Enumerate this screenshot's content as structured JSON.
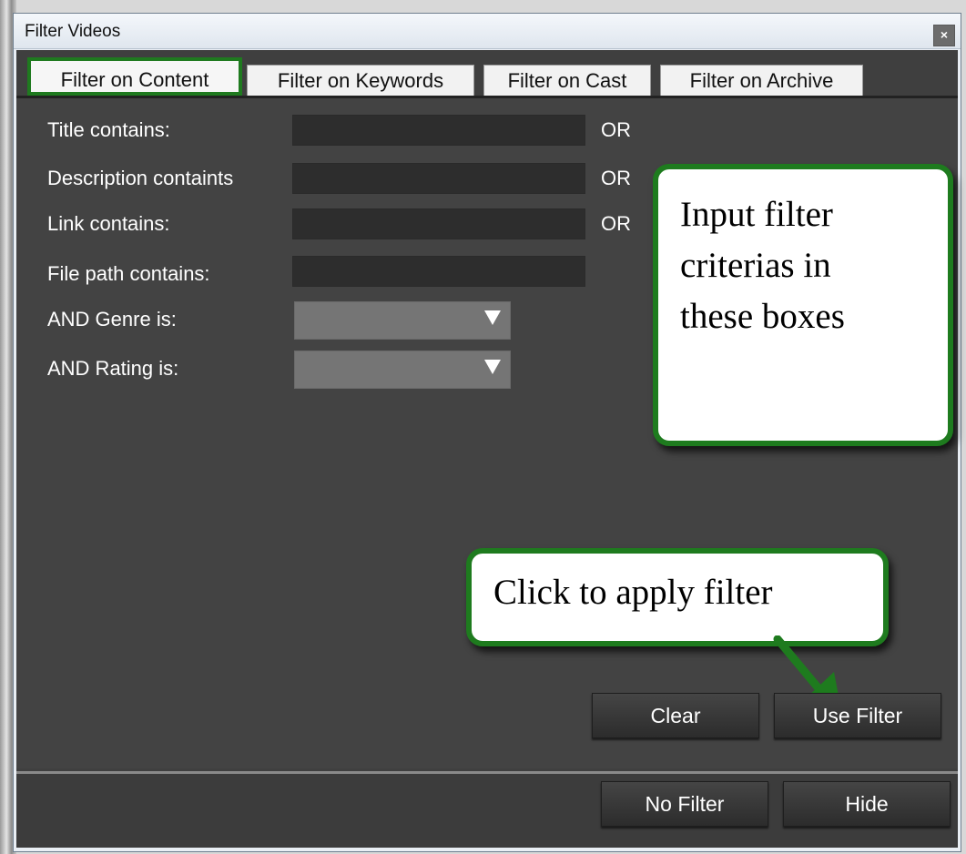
{
  "window": {
    "title": "Filter Videos",
    "close_icon": "×"
  },
  "tabs": [
    {
      "label": "Filter on Content"
    },
    {
      "label": "Filter on Keywords"
    },
    {
      "label": "Filter on Cast"
    },
    {
      "label": "Filter on Archive"
    }
  ],
  "fields": [
    {
      "label": "Title contains:",
      "value": "",
      "suffix": "OR"
    },
    {
      "label": "Description containts",
      "value": "",
      "suffix": "OR"
    },
    {
      "label": "Link contains:",
      "value": "",
      "suffix": "OR"
    },
    {
      "label": "File path contains:",
      "value": ""
    }
  ],
  "selects": [
    {
      "label": "AND Genre is:",
      "value": ""
    },
    {
      "label": "AND Rating is:",
      "value": ""
    }
  ],
  "callouts": {
    "input": {
      "lines": [
        "Input filter",
        "criterias in",
        "these boxes"
      ]
    },
    "apply": {
      "text": "Click to apply filter"
    }
  },
  "buttons": {
    "clear": "Clear",
    "use_filter": "Use Filter",
    "no_filter": "No Filter",
    "hide": "Hide"
  },
  "colors": {
    "accent": "#1e7b1e",
    "panel": "#434343"
  }
}
